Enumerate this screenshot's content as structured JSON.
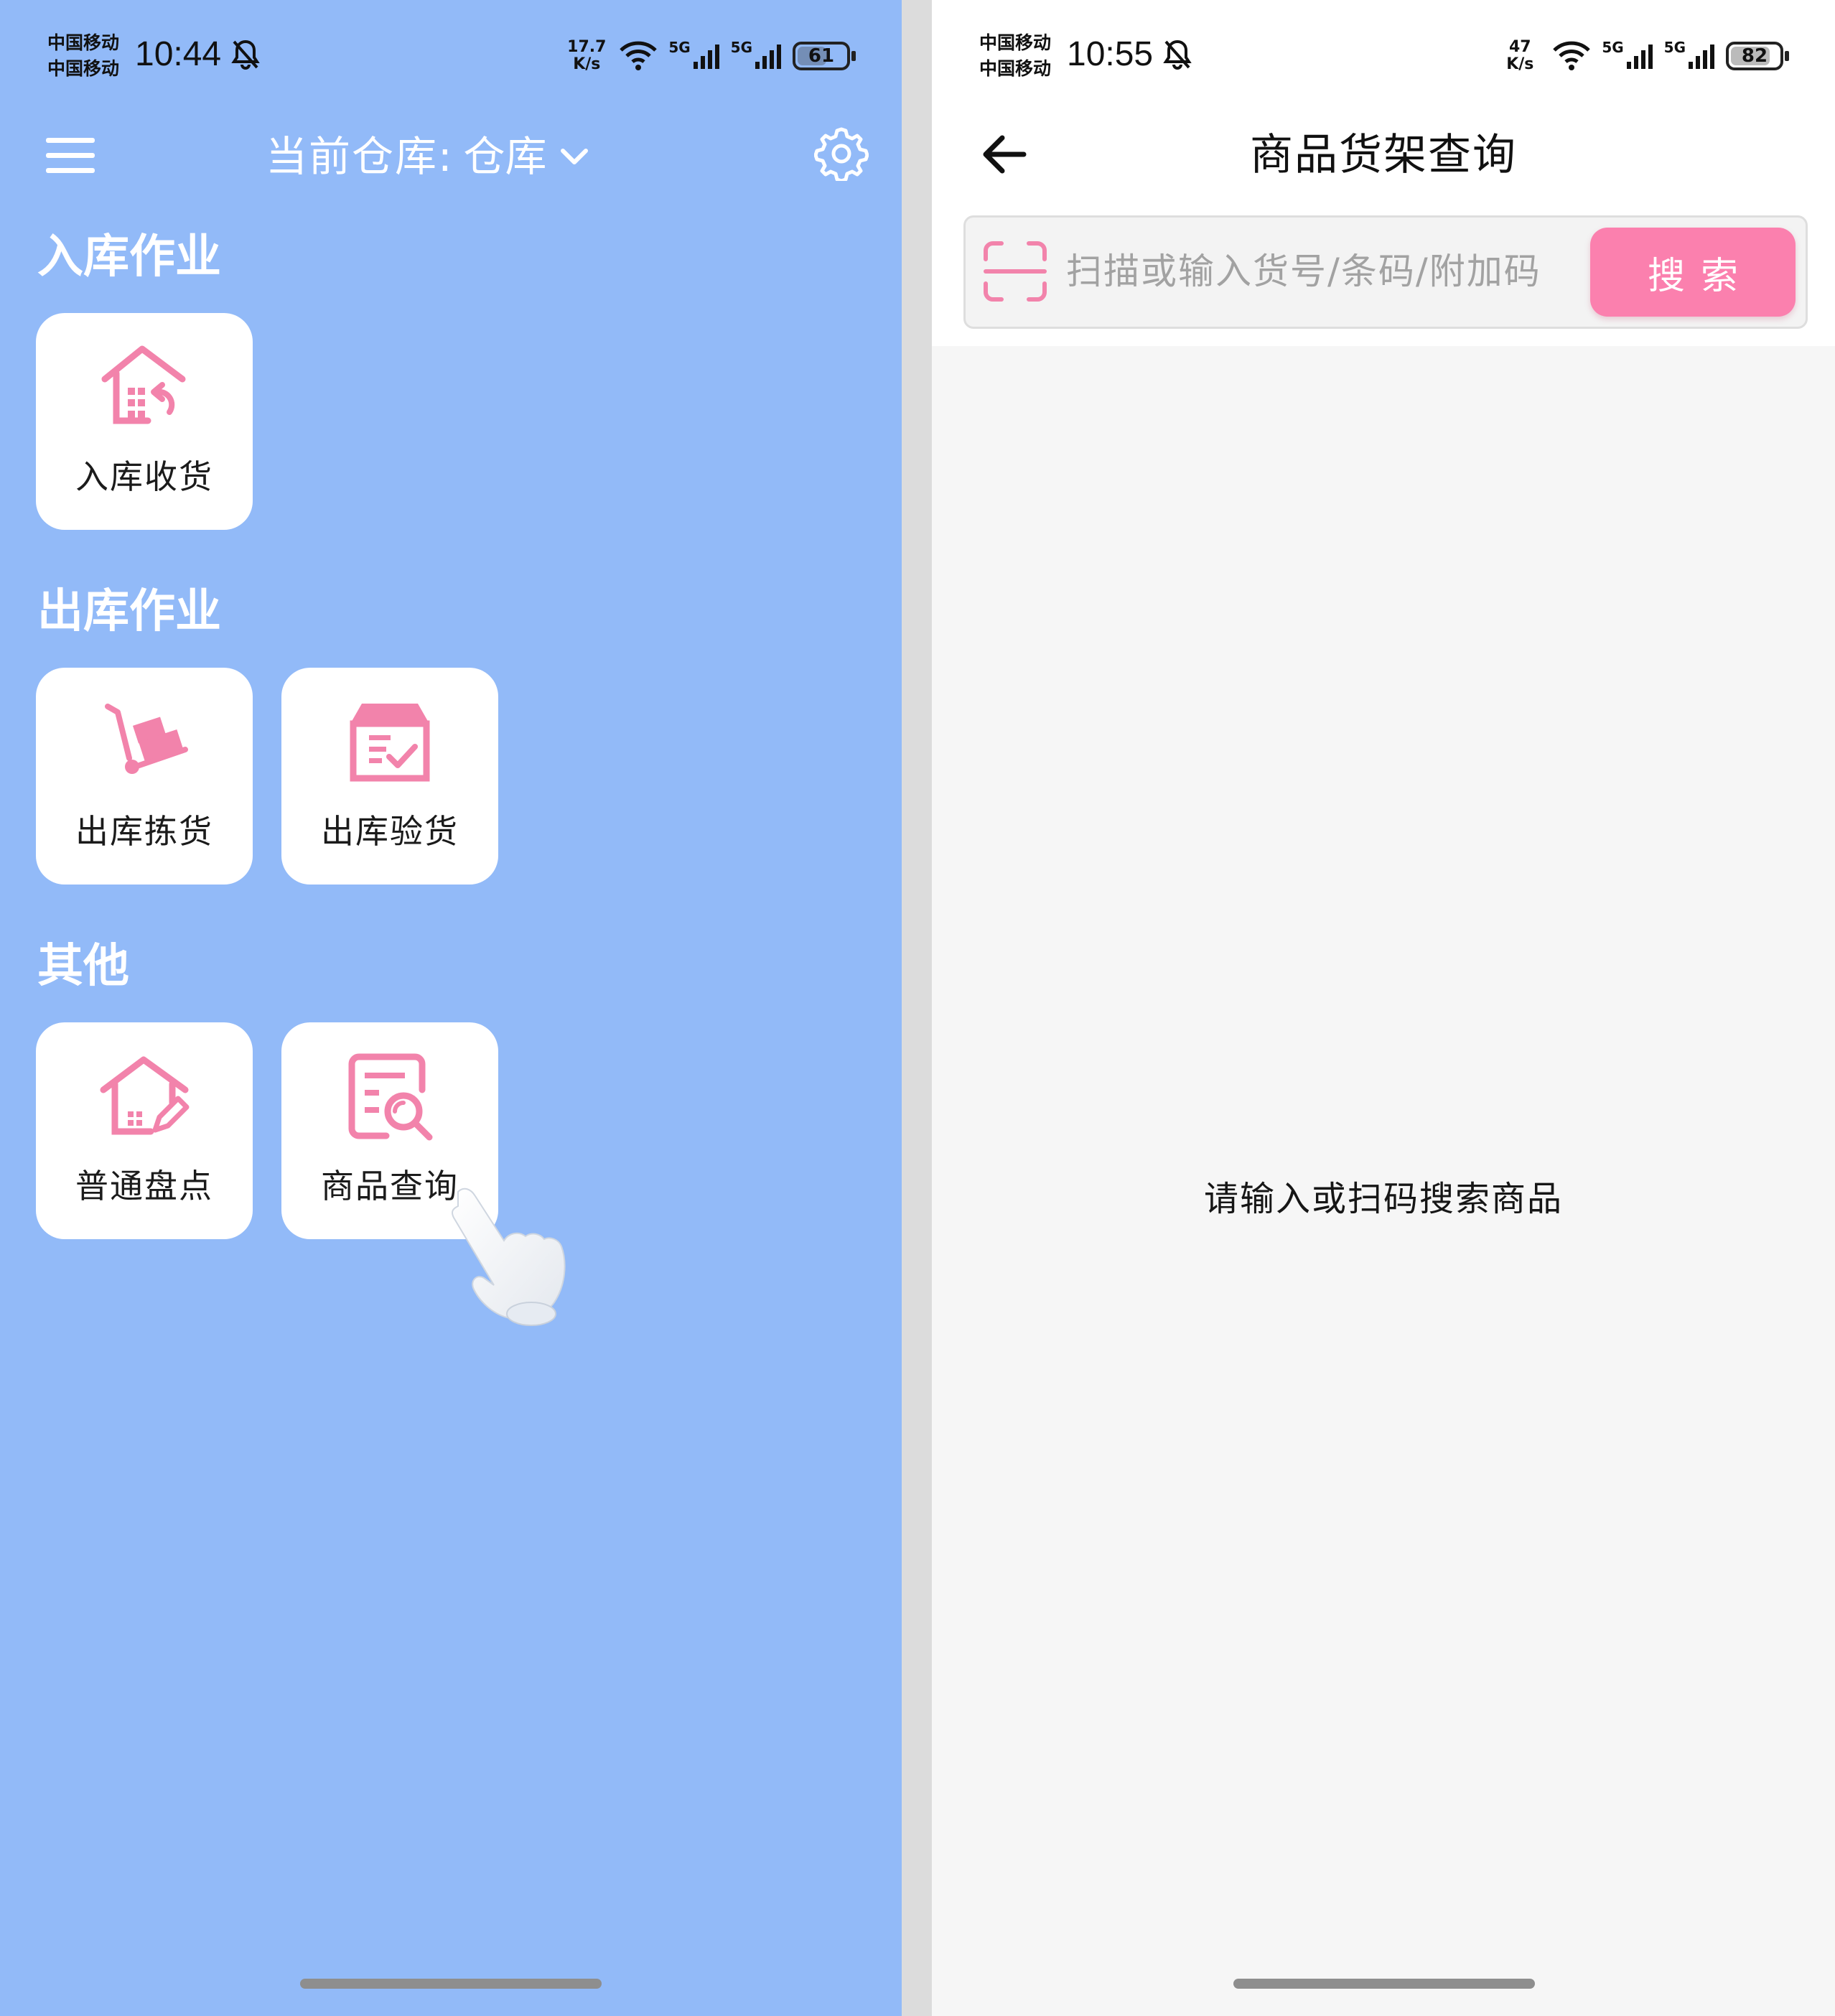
{
  "left": {
    "status": {
      "carrier1": "中国移动",
      "carrier2": "中国移动",
      "time": "10:44",
      "speed_value": "17.7",
      "speed_unit": "K/s",
      "signal_label": "5G",
      "signal_label2": "5G",
      "battery": "61",
      "battery_level": 0.61
    },
    "header": {
      "warehouse_label": "当前仓库:",
      "warehouse_value": "仓库"
    },
    "sections": [
      {
        "title": "入库作业",
        "tiles": [
          {
            "label": "入库收货",
            "icon": "warehouse-return-icon"
          }
        ]
      },
      {
        "title": "出库作业",
        "tiles": [
          {
            "label": "出库拣货",
            "icon": "hand-truck-icon"
          },
          {
            "label": "出库验货",
            "icon": "box-check-icon"
          }
        ]
      },
      {
        "title": "其他",
        "tiles": [
          {
            "label": "普通盘点",
            "icon": "house-edit-icon"
          },
          {
            "label": "商品查询",
            "icon": "document-search-icon"
          }
        ]
      }
    ]
  },
  "right": {
    "status": {
      "carrier1": "中国移动",
      "carrier2": "中国移动",
      "time": "10:55",
      "speed_value": "47",
      "speed_unit": "K/s",
      "signal_label": "5G",
      "signal_label2": "5G",
      "battery": "82",
      "battery_level": 0.82
    },
    "title": "商品货架查询",
    "search": {
      "placeholder": "扫描或输入货号/条码/附加码",
      "value": "",
      "button": "搜索"
    },
    "empty_message": "请输入或扫码搜索商品"
  },
  "colors": {
    "left_bg": "#92baf8",
    "accent_pink": "#fb80ae",
    "icon_pink": "#f283ab",
    "right_bg": "#f6f6f6"
  }
}
